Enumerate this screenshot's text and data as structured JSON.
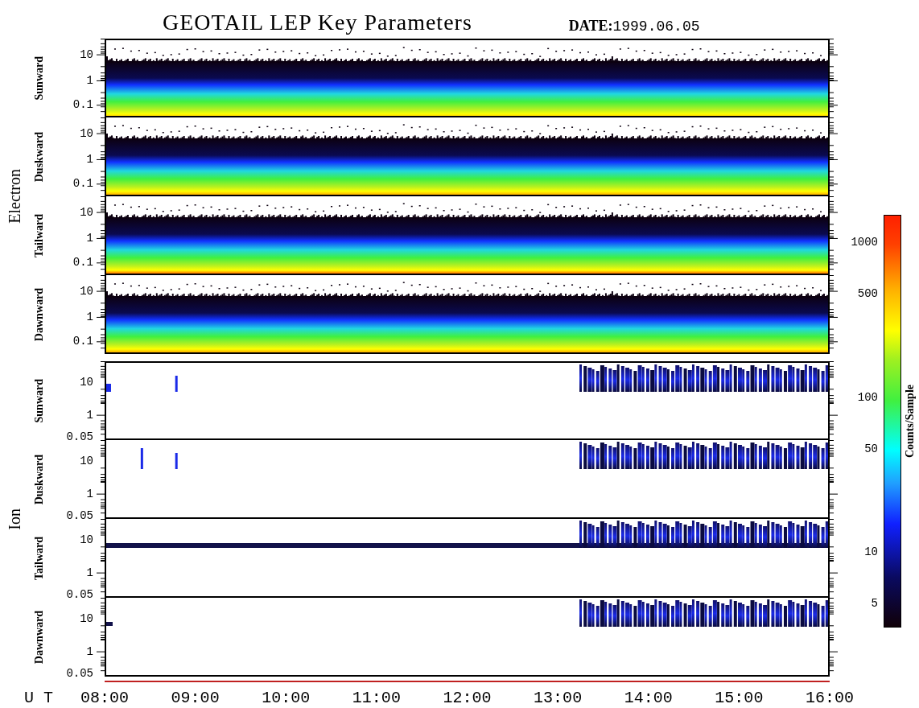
{
  "title": "GEOTAIL LEP Key Parameters",
  "date": {
    "label": "DATE:",
    "value": "1999.06.05"
  },
  "groups": [
    {
      "name": "Electron",
      "panels": [
        {
          "label": "Sunward",
          "yticks": [
            "10",
            "1",
            "0.1"
          ]
        },
        {
          "label": "Duskward",
          "yticks": [
            "10",
            "1",
            "0.1"
          ]
        },
        {
          "label": "Tailward",
          "yticks": [
            "10",
            "1",
            "0.1"
          ]
        },
        {
          "label": "Dawnward",
          "yticks": [
            "10",
            "1",
            "0.1"
          ]
        }
      ]
    },
    {
      "name": "Ion",
      "panels": [
        {
          "label": "Sunward",
          "yticks": [
            "10",
            "1",
            "0.05"
          ]
        },
        {
          "label": "Duskward",
          "yticks": [
            "10",
            "1",
            "0.05"
          ]
        },
        {
          "label": "Tailward",
          "yticks": [
            "10",
            "1",
            "0.05"
          ]
        },
        {
          "label": "Dawnward",
          "yticks": [
            "10",
            "1",
            "0.05"
          ]
        }
      ]
    }
  ],
  "colorbar": {
    "title": "Counts/Sample",
    "ticks": [
      "1000",
      "500",
      "100",
      "50",
      "10",
      "5"
    ]
  },
  "xaxis": {
    "label": "U T",
    "ticks": [
      "08:00",
      "09:00",
      "10:00",
      "11:00",
      "12:00",
      "13:00",
      "14:00",
      "15:00",
      "16:00"
    ]
  }
}
